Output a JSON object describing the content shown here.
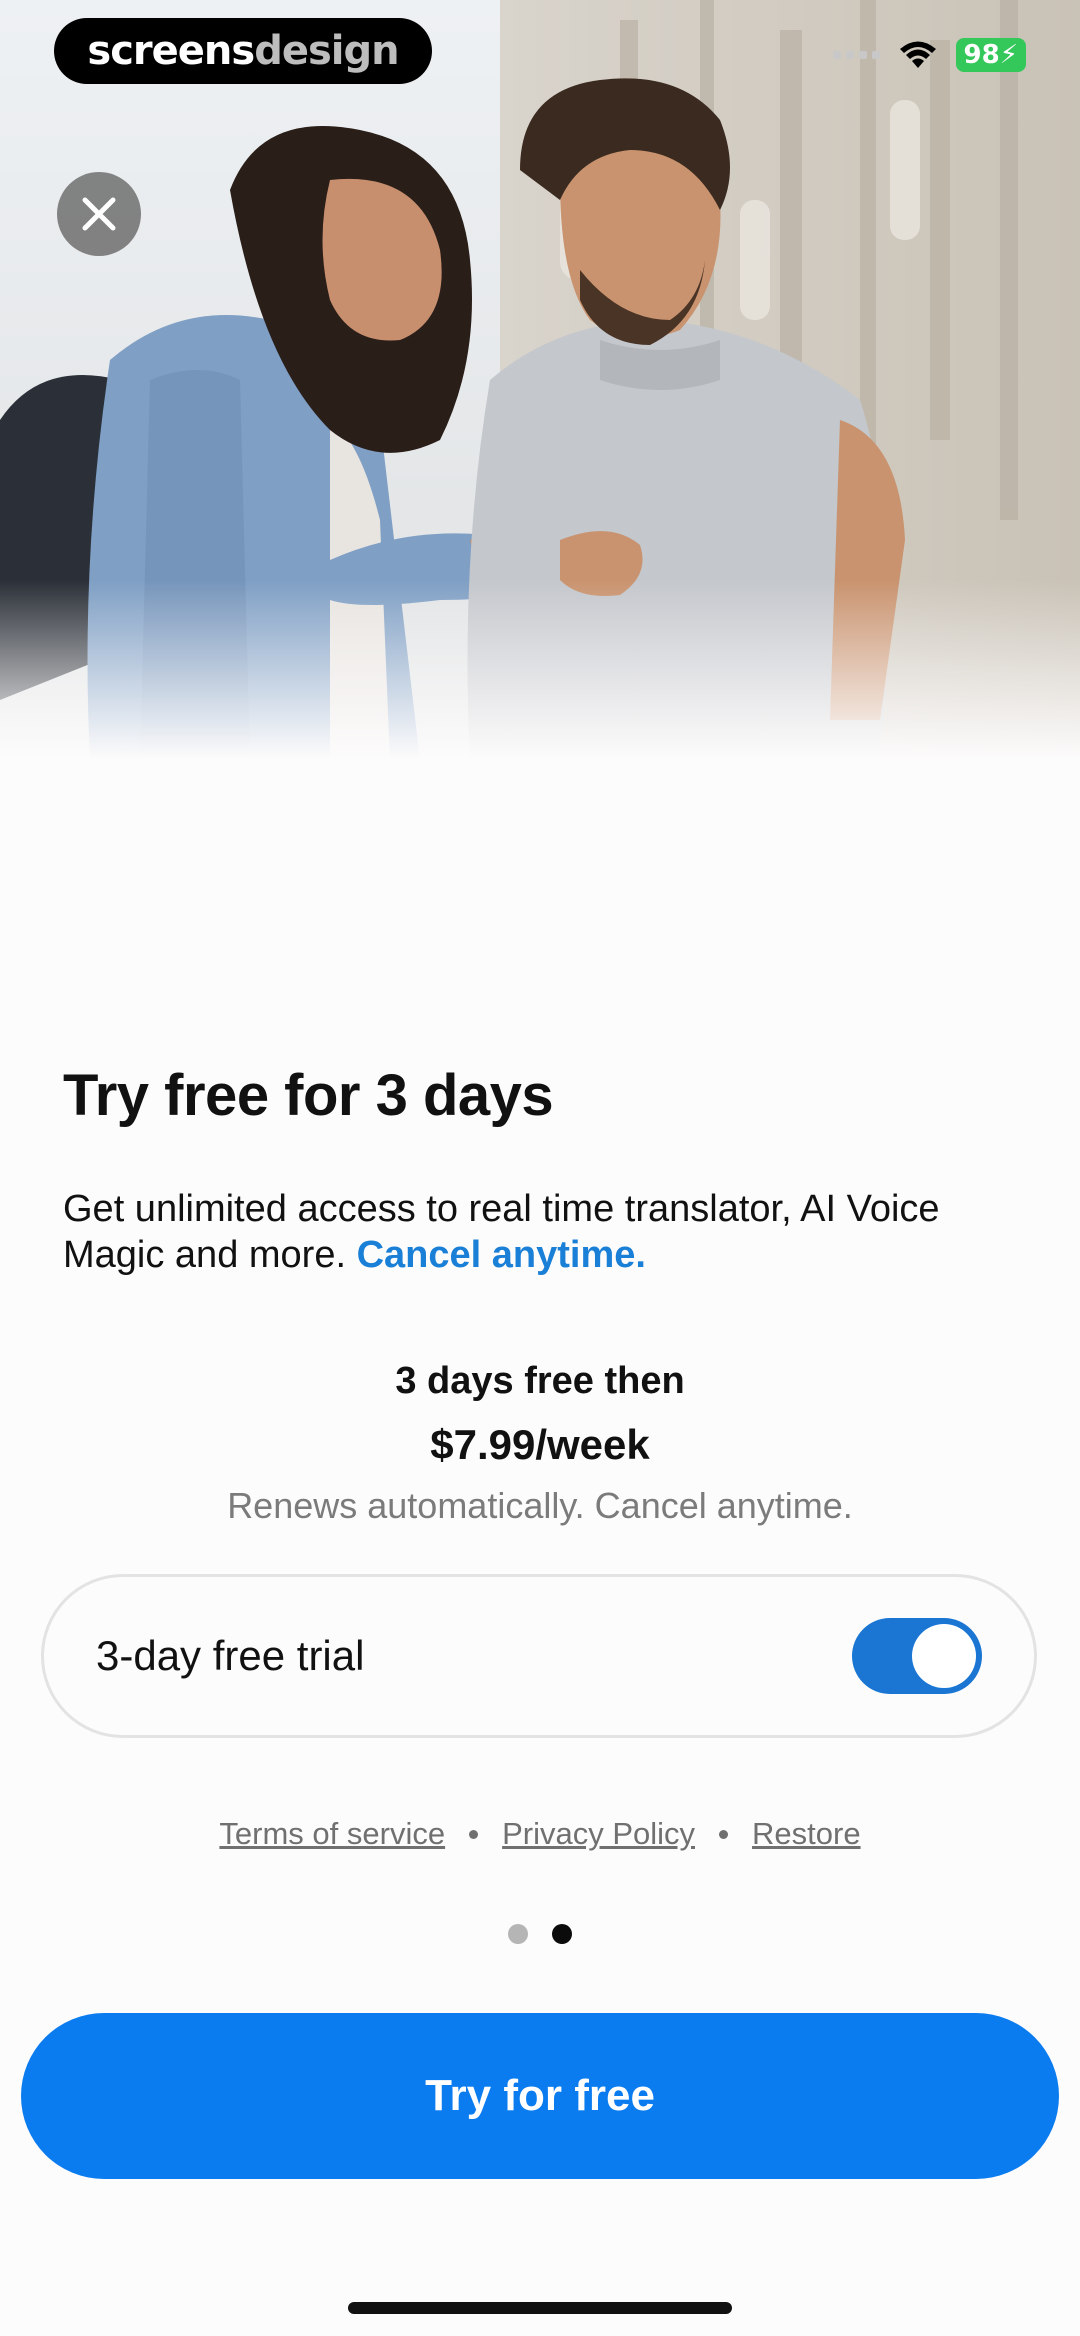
{
  "watermark": {
    "part1": "screens",
    "part2": "design"
  },
  "status_bar": {
    "battery": "98"
  },
  "hero": {
    "icon": "close-icon"
  },
  "paywall": {
    "title": "Try free for 3 days",
    "subtitle_text": "Get unlimited access to real time translator, AI Voice Magic and more.",
    "subtitle_link": "Cancel anytime.",
    "price_intro": "3 days free then",
    "price": "$7.99/week",
    "renewal_note": "Renews automatically. Cancel anytime.",
    "trial_toggle": {
      "label": "3-day free trial",
      "enabled": true
    },
    "links": [
      "Terms of service",
      "Privacy Policy",
      "Restore"
    ],
    "pager": {
      "total": 2,
      "active_index": 1
    },
    "cta_label": "Try for free"
  },
  "colors": {
    "accent": "#0a7cf0",
    "link": "#1a7fd6",
    "toggle_on": "#1a76d2",
    "battery": "#34c759"
  }
}
